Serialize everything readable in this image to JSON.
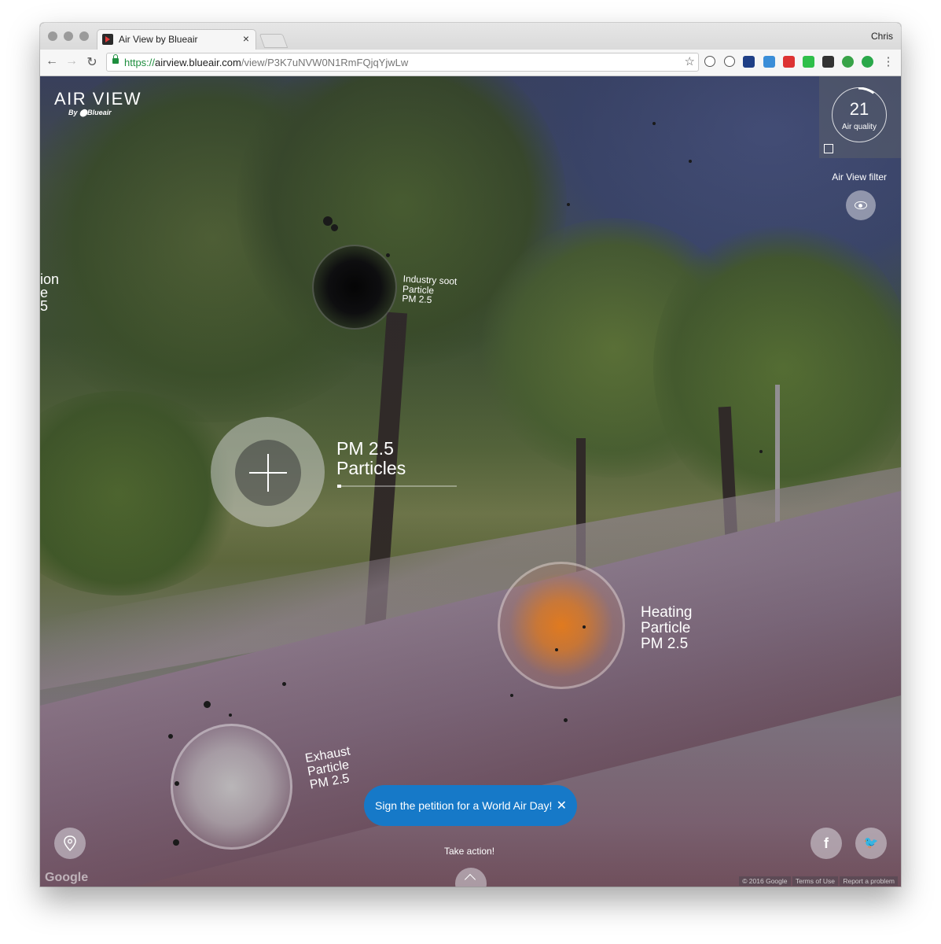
{
  "browser": {
    "tab_title": "Air View by Blueair",
    "tab_close": "×",
    "profile_name": "Chris",
    "url_scheme": "https://",
    "url_host": "airview.blueair.com",
    "url_path": "/view/P3K7uNVW0N1RmFQjqYjwLw",
    "back": "←",
    "forward": "→",
    "reload": "↻",
    "star": "☆",
    "menu": "⋮"
  },
  "app": {
    "logo_title": "AIR VIEW",
    "logo_by": "By ⬤Blueair",
    "air_quality": {
      "value": "21",
      "label": "Air quality",
      "ring_progress": 0.1
    },
    "filter_label": "Air View filter",
    "filter_icon": "eye-icon",
    "edge_label_lines": [
      "ion",
      "e",
      "5"
    ],
    "particles": [
      {
        "id": "industry",
        "lines": [
          "Industry soot",
          "Particle",
          "PM 2.5"
        ],
        "color": "#111111"
      },
      {
        "id": "heating",
        "lines": [
          "Heating",
          "Particle",
          "PM 2.5"
        ],
        "color": "#e07a1f"
      },
      {
        "id": "exhaust",
        "lines": [
          "Exhaust",
          "Particle",
          "PM 2.5"
        ],
        "color": "#b9b6b8"
      }
    ],
    "pm_focus": {
      "title": "PM 2.5",
      "subtitle": "Particles",
      "progress": 0.03
    },
    "cta": {
      "text": "Sign the petition for a World Air Day!",
      "close": "✕"
    },
    "take_action": "Take action!",
    "social": {
      "facebook": "f",
      "twitter": "🐦"
    },
    "google_mark": "Google",
    "legal": [
      "© 2016 Google",
      "Terms of Use",
      "Report a problem"
    ]
  }
}
